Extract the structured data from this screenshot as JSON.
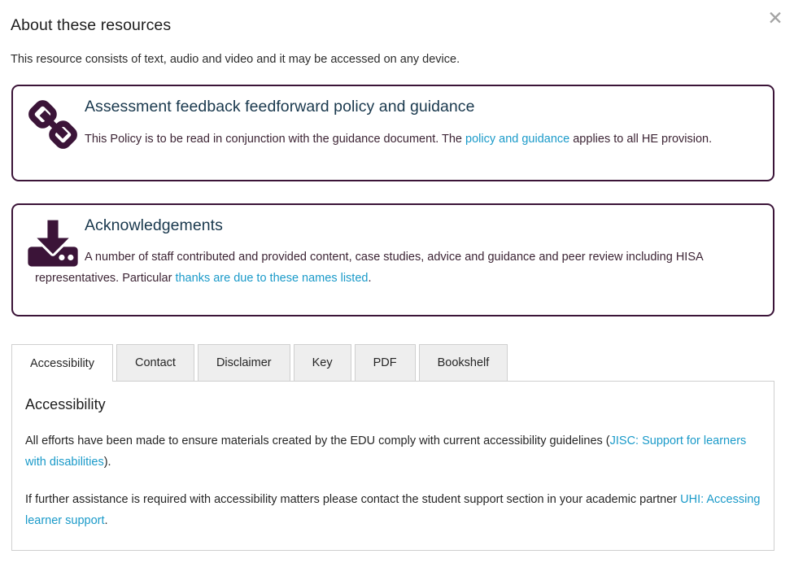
{
  "header": {
    "title": "About these resources",
    "close_label": "✕",
    "close_icon": "close-icon"
  },
  "intro": {
    "text": "This resource consists of text, audio and video and it may be accessed on any device."
  },
  "cards": [
    {
      "id": "card-policy",
      "icon": "chain-link-icon",
      "title": "Assessment feedback feedforward policy and guidance",
      "text_before": "This Policy is to be read in conjunction with the guidance document. The ",
      "link_text": "policy and guidance",
      "text_after": " applies to all HE provision."
    },
    {
      "id": "card-ack",
      "icon": "download-icon",
      "title": "Acknowledgements",
      "text_before": "A number of staff contributed and provided content, case studies, advice and guidance and peer review including HISA representatives. Particular ",
      "link_text": "thanks are due to these names listed",
      "text_after": "."
    }
  ],
  "tabs": {
    "items": [
      {
        "label": "Accessibility",
        "active": true
      },
      {
        "label": "Contact",
        "active": false
      },
      {
        "label": "Disclaimer",
        "active": false
      },
      {
        "label": "Key",
        "active": false
      },
      {
        "label": "PDF",
        "active": false
      },
      {
        "label": "Bookshelf",
        "active": false
      }
    ],
    "panel": {
      "title": "Accessibility",
      "paragraph1_before": "All efforts have been made to ensure materials created by the EDU comply with current accessibility guidelines (",
      "paragraph1_link": "JISC: Support for learners with disabilities",
      "paragraph1_after": ").",
      "paragraph2_before": "If further assistance is required with accessibility matters please contact the student support section in your academic partner ",
      "paragraph2_link": "UHI: Accessing learner support",
      "paragraph2_after": "."
    }
  },
  "colors": {
    "card_border": "#3b1438",
    "icon": "#3b1438",
    "card_title": "#19384d",
    "link": "#1a9ac9",
    "tab_inactive_bg": "#eeeeee",
    "tab_border": "#cfcfcf",
    "close": "#a3a3a3"
  }
}
